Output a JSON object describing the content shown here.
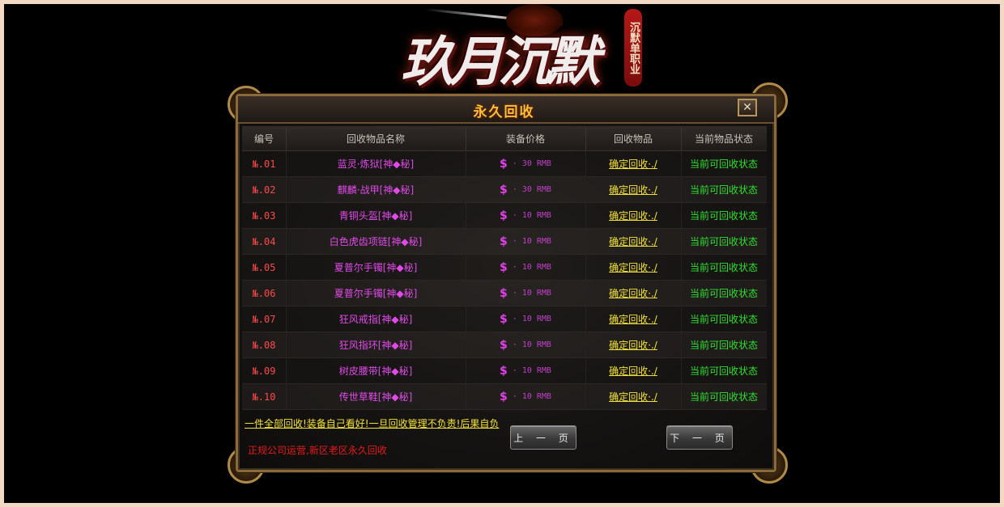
{
  "logo": {
    "title": "玖月沉默",
    "subtitle": "沉默单职业"
  },
  "panel": {
    "title": "永久回收",
    "close_symbol": "✕"
  },
  "table": {
    "headers": [
      "编号",
      "回收物品名称",
      "装备价格",
      "回收物品",
      "当前物品状态"
    ],
    "currency_symbol": "$",
    "rows": [
      {
        "id": "№.01",
        "name": "蓝灵·炼狱[神◆秘]",
        "price": "·  30 RMB",
        "action": "确定回收·./",
        "status": "当前可回收状态"
      },
      {
        "id": "№.02",
        "name": "麒麟·战甲[神◆秘]",
        "price": "·  30 RMB",
        "action": "确定回收·./",
        "status": "当前可回收状态"
      },
      {
        "id": "№.03",
        "name": "青铜头盔[神◆秘]",
        "price": "·  10  RMB",
        "action": "确定回收·./",
        "status": "当前可回收状态"
      },
      {
        "id": "№.04",
        "name": "白色虎齿项链[神◆秘]",
        "price": "·  10  RMB",
        "action": "确定回收·./",
        "status": "当前可回收状态"
      },
      {
        "id": "№.05",
        "name": "夏普尔手镯[神◆秘]",
        "price": "·  10  RMB",
        "action": "确定回收·./",
        "status": "当前可回收状态"
      },
      {
        "id": "№.06",
        "name": "夏普尔手镯[神◆秘]",
        "price": "·  10  RMB",
        "action": "确定回收·./",
        "status": "当前可回收状态"
      },
      {
        "id": "№.07",
        "name": "狂风戒指[神◆秘]",
        "price": "·  10  RMB",
        "action": "确定回收·./",
        "status": "当前可回收状态"
      },
      {
        "id": "№.08",
        "name": "狂风指环[神◆秘]",
        "price": "·  10  RMB",
        "action": "确定回收·./",
        "status": "当前可回收状态"
      },
      {
        "id": "№.09",
        "name": "树皮腰带[神◆秘]",
        "price": "·  10  RMB",
        "action": "确定回收·./",
        "status": "当前可回收状态"
      },
      {
        "id": "№.10",
        "name": "传世草鞋[神◆秘]",
        "price": "·  10  RMB",
        "action": "确定回收·./",
        "status": "当前可回收状态"
      }
    ]
  },
  "footer": {
    "notice": "一件全部回收!装备自己看好!一旦回收管理不负责!后果自负",
    "note": "正规公司运营,新区老区永久回收",
    "prev_label": "上 一 页",
    "next_label": "下 一 页"
  },
  "colors": {
    "id": "#ff4a4a",
    "item_name": "#e04ae8",
    "action_link": "#f2e23a",
    "status": "#2ee02e",
    "title": "#f2c23a",
    "note": "#e81a1a"
  }
}
